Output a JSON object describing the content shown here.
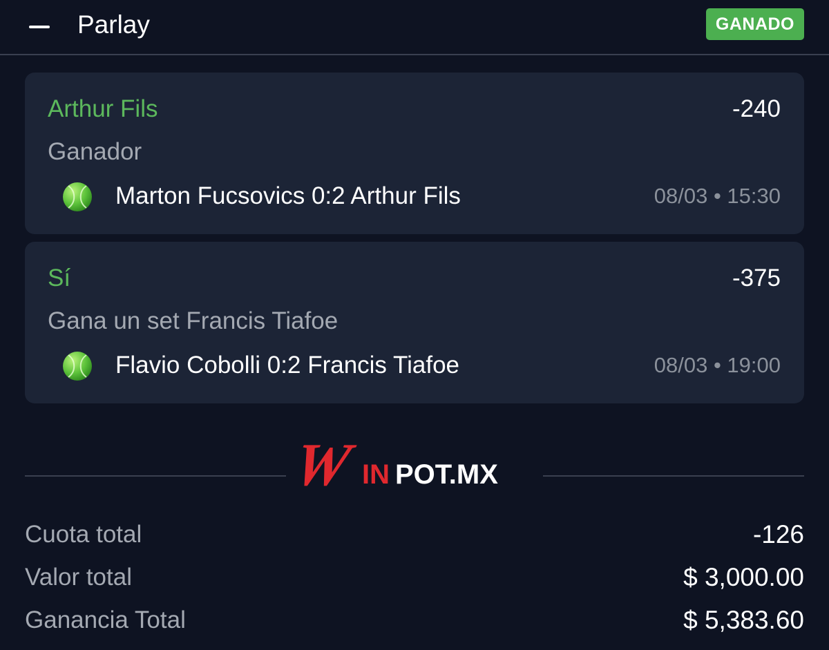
{
  "header": {
    "title": "Parlay",
    "status_badge": "GANADO"
  },
  "selections": [
    {
      "pick": "Arthur Fils",
      "odds": "-240",
      "market": "Ganador",
      "sport_icon": "tennis-ball-icon",
      "match": "Marton Fucsovics 0:2 Arthur Fils",
      "datetime": "08/03 • 15:30"
    },
    {
      "pick": "Sí",
      "odds": "-375",
      "market": "Gana un set Francis Tiafoe",
      "sport_icon": "tennis-ball-icon",
      "match": "Flavio Cobolli 0:2 Francis Tiafoe",
      "datetime": "08/03 • 19:00"
    }
  ],
  "brand": {
    "logo_text_w": "W",
    "logo_text_in": "IN",
    "logo_text_rest": "POT.MX",
    "logo_red": "#e0282e"
  },
  "summary": [
    {
      "label": "Cuota total",
      "value": "-126"
    },
    {
      "label": "Valor total",
      "value": "$ 3,000.00"
    },
    {
      "label": "Ganancia Total",
      "value": "$ 5,383.60"
    }
  ],
  "colors": {
    "background": "#0e1322",
    "card": "#1c2436",
    "win_green": "#4caf50",
    "pick_green": "#5cb85c"
  }
}
